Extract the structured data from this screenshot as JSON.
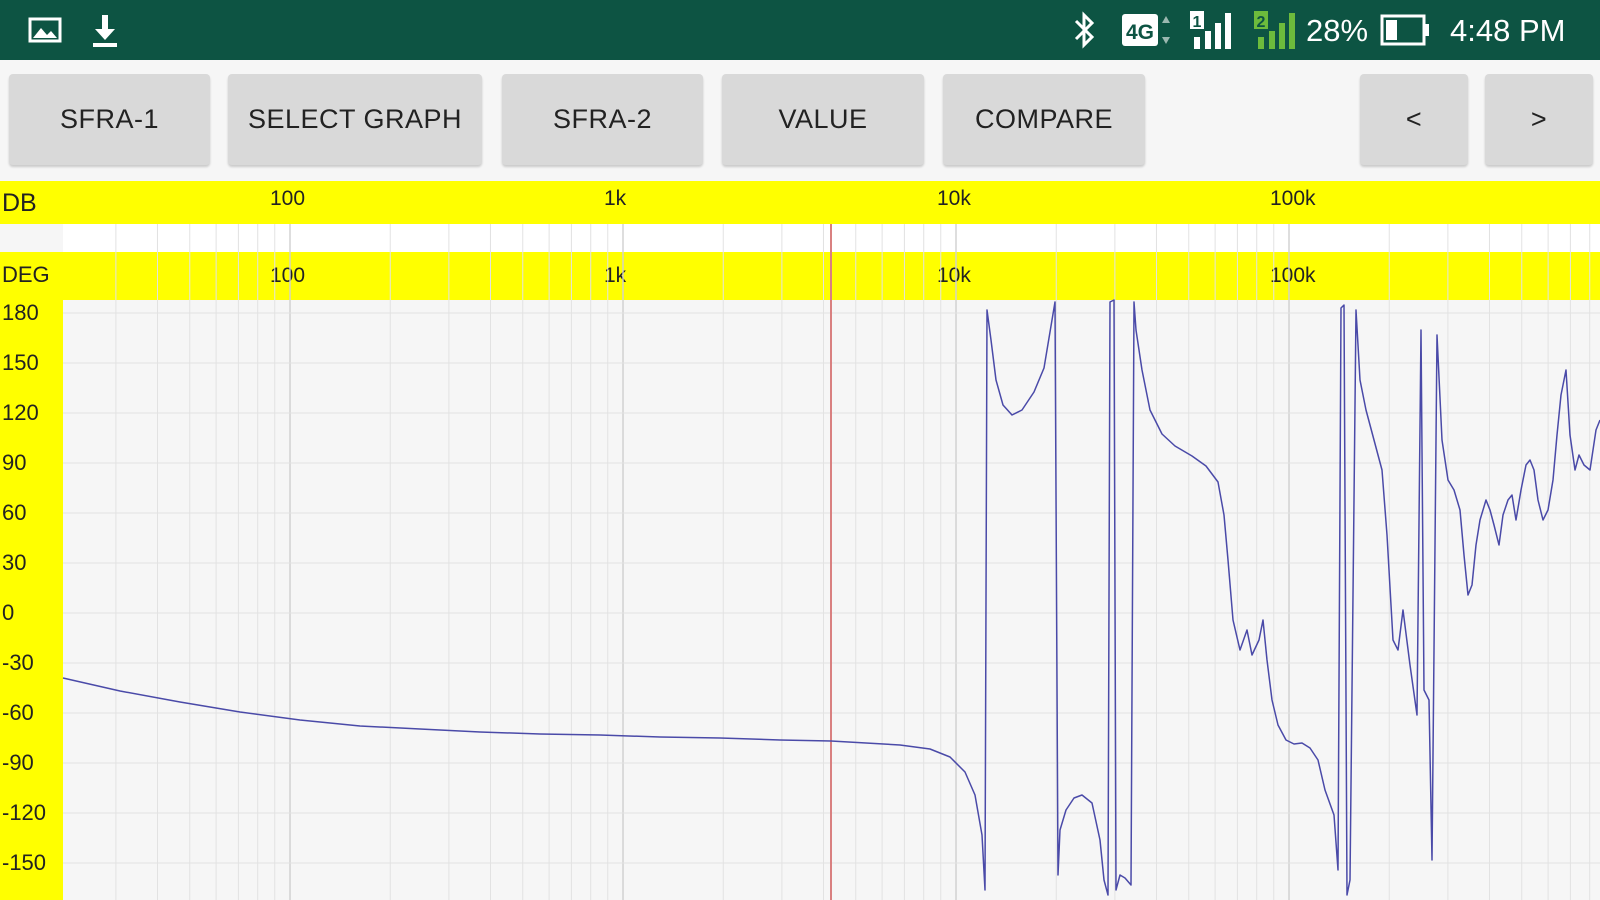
{
  "status_bar": {
    "battery": "28%",
    "time": "4:48 PM",
    "network": "4G",
    "sim1": "1",
    "sim2": "2",
    "icons": [
      "gallery-icon",
      "download-icon",
      "bluetooth-icon",
      "4g-icon",
      "signal-sim1-icon",
      "signal-sim2-icon",
      "battery-icon"
    ]
  },
  "toolbar": {
    "sfra1": "SFRA-1",
    "select_graph": "SELECT GRAPH",
    "sfra2": "SFRA-2",
    "value": "VALUE",
    "compare": "COMPARE",
    "prev": "<",
    "next": ">"
  },
  "graph": {
    "db_label": "DB",
    "deg_label": "DEG",
    "db_freq_labels": [
      "100",
      "1k",
      "10k",
      "100k"
    ],
    "deg_freq_labels": [
      "100",
      "1k",
      "10k",
      "100k"
    ],
    "y_ticks": [
      "180",
      "150",
      "120",
      "90",
      "60",
      "30",
      "0",
      "-30",
      "-60",
      "-90",
      "-120",
      "-150"
    ]
  },
  "colors": {
    "status_bar": "#0d5443",
    "band": "#ffff00",
    "button": "#d9d9d9",
    "trace": "#4a4aa8",
    "cursor": "#d98080",
    "grid": "#e2e2e2"
  }
}
